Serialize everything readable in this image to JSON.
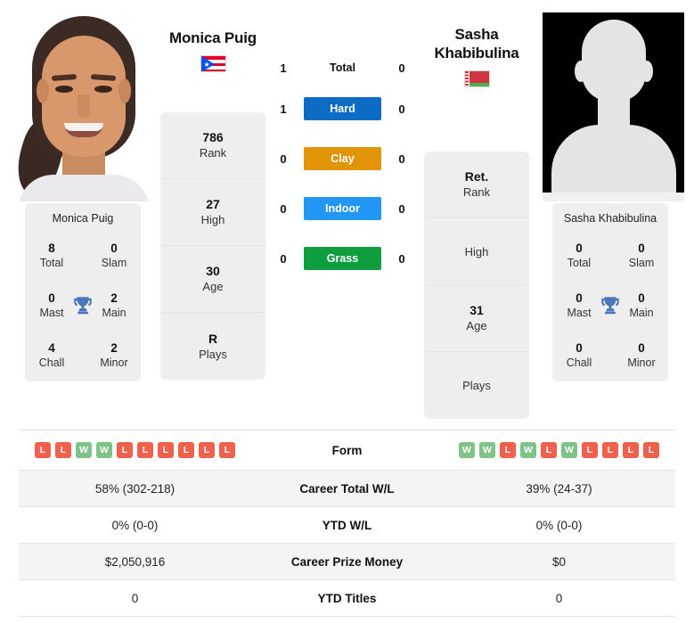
{
  "players": {
    "left": {
      "name": "Monica Puig",
      "flag": "puerto-rico-flag",
      "panel_name": "Monica Puig",
      "rank": "786",
      "rank_label": "Rank",
      "high": "27",
      "high_label": "High",
      "age": "30",
      "age_label": "Age",
      "plays": "R",
      "plays_label": "Plays",
      "titles": {
        "total": "8",
        "total_label": "Total",
        "slam": "0",
        "slam_label": "Slam",
        "mast": "0",
        "mast_label": "Mast",
        "main": "2",
        "main_label": "Main",
        "chall": "4",
        "chall_label": "Chall",
        "minor": "2",
        "minor_label": "Minor"
      },
      "form": [
        "L",
        "L",
        "W",
        "W",
        "L",
        "L",
        "L",
        "L",
        "L",
        "L"
      ],
      "career_total_wl": "58% (302-218)",
      "ytd_wl": "0% (0-0)",
      "career_prize_money": "$2,050,916",
      "ytd_titles": "0",
      "h2h": {
        "total": "1",
        "hard": "1",
        "clay": "0",
        "indoor": "0",
        "grass": "0"
      }
    },
    "right": {
      "name": "Sasha Khabibulina",
      "name_line1": "Sasha",
      "name_line2": "Khabibulina",
      "flag": "belarus-flag",
      "panel_name": "Sasha Khabibulina",
      "rank": "Ret.",
      "rank_label": "Rank",
      "high": "",
      "high_label": "High",
      "age": "31",
      "age_label": "Age",
      "plays": "",
      "plays_label": "Plays",
      "titles": {
        "total": "0",
        "total_label": "Total",
        "slam": "0",
        "slam_label": "Slam",
        "mast": "0",
        "mast_label": "Mast",
        "main": "0",
        "main_label": "Main",
        "chall": "0",
        "chall_label": "Chall",
        "minor": "0",
        "minor_label": "Minor"
      },
      "form": [
        "W",
        "W",
        "L",
        "W",
        "L",
        "W",
        "L",
        "L",
        "L",
        "L"
      ],
      "career_total_wl": "39% (24-37)",
      "ytd_wl": "0% (0-0)",
      "career_prize_money": "$0",
      "ytd_titles": "0",
      "h2h": {
        "total": "0",
        "hard": "0",
        "clay": "0",
        "indoor": "0",
        "grass": "0"
      }
    }
  },
  "surfaces": {
    "total_label": "Total",
    "hard_label": "Hard",
    "clay_label": "Clay",
    "indoor_label": "Indoor",
    "grass_label": "Grass",
    "colors": {
      "hard": "#0c6cc4",
      "clay": "#e29408",
      "indoor": "#2196f3",
      "grass": "#0f9e3e"
    }
  },
  "stats_table": {
    "rows": [
      {
        "label": "Form"
      },
      {
        "label": "Career Total W/L"
      },
      {
        "label": "YTD W/L"
      },
      {
        "label": "Career Prize Money"
      },
      {
        "label": "YTD Titles"
      }
    ]
  },
  "theme": {
    "panel_bg": "#eeeeee",
    "row_alt_bg": "#f4f4f4",
    "win_color": "#7fc389",
    "loss_color": "#f0614d",
    "trophy_color": "#4a76b8"
  }
}
